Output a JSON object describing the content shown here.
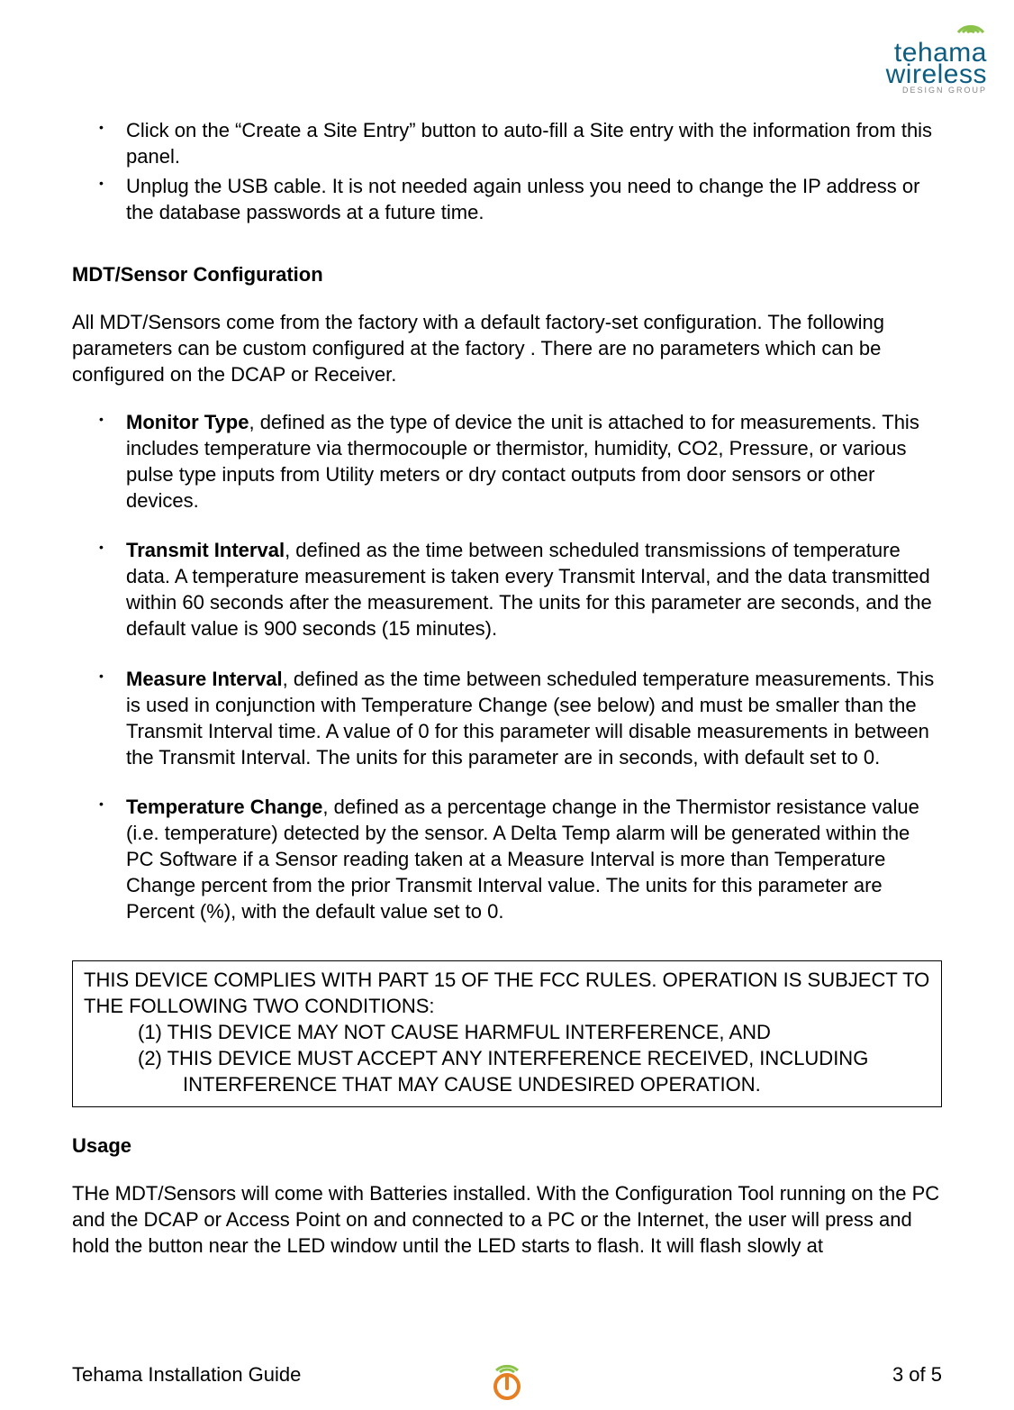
{
  "logo": {
    "top_line": "tehama",
    "bottom_line": "wireless",
    "tagline": "DESIGN GROUP"
  },
  "intro_bullets": [
    "Click on the “Create a Site Entry” button to auto-fill a Site entry with the information from this panel.",
    "Unplug the USB cable.  It is not needed again unless you need to change the IP address or the database passwords at a future time."
  ],
  "section1": {
    "heading": "MDT/Sensor Configuration",
    "intro": "All MDT/Sensors come from the factory with a default factory-set configuration.  The following parameters can be custom configured at the factory . There are no parameters which can be configured on the DCAP or Receiver.",
    "items": [
      {
        "term": "Monitor Type",
        "desc": ", defined as the type of device the unit is attached to for measurements.  This includes temperature via thermocouple or thermistor, humidity, CO2, Pressure, or various pulse type inputs from Utility meters or dry contact outputs from door sensors or other devices."
      },
      {
        "term": "Transmit Interval",
        "desc": ", defined as the time between scheduled transmissions of temperature data.  A temperature measurement is taken every Transmit Interval, and the data transmitted within 60 seconds after the measurement.  The units for this parameter are seconds, and the default value is 900 seconds (15 minutes)."
      },
      {
        "term": "Measure Interval",
        "desc": ", defined as the time between scheduled temperature measurements.  This is used in conjunction with Temperature Change (see below) and must be smaller than the Transmit Interval time.  A value of 0 for this parameter will disable measurements in between the Transmit Interval.  The units for this parameter are in seconds, with default set to 0."
      },
      {
        "term": "Temperature Change",
        "desc": ", defined as a percentage change in the Thermistor resistance value (i.e. temperature) detected by the sensor.  A Delta Temp alarm will be generated within the PC Software if a Sensor reading taken at a Measure Interval is more than Temperature Change percent from the prior Transmit Interval value.  The units for this parameter are Percent (%), with the default value set to 0."
      }
    ]
  },
  "fcc": {
    "line1": "THIS DEVICE COMPLIES WITH PART 15 OF THE FCC RULES.  OPERATION IS SUBJECT TO THE FOLLOWING TWO CONDITIONS:",
    "cond1_label": "(1) ",
    "cond1": "THIS DEVICE MAY NOT CAUSE HARMFUL INTERFERENCE, AND",
    "cond2_label": "(2) ",
    "cond2": "THIS DEVICE MUST ACCEPT ANY INTERFERENCE RECEIVED, INCLUDING",
    "cond2_cont": "INTERFERENCE THAT MAY CAUSE UNDESIRED OPERATION."
  },
  "section2": {
    "heading": "Usage",
    "para": "THe MDT/Sensors will come with Batteries installed.  With the Configuration Tool running on the PC and the DCAP or Access Point on and connected to a PC or the Internet, the user will press and hold the button near the LED window until the LED starts to flash.  It will flash slowly at"
  },
  "footer": {
    "left": "Tehama Installation Guide",
    "right": "3 of 5"
  }
}
